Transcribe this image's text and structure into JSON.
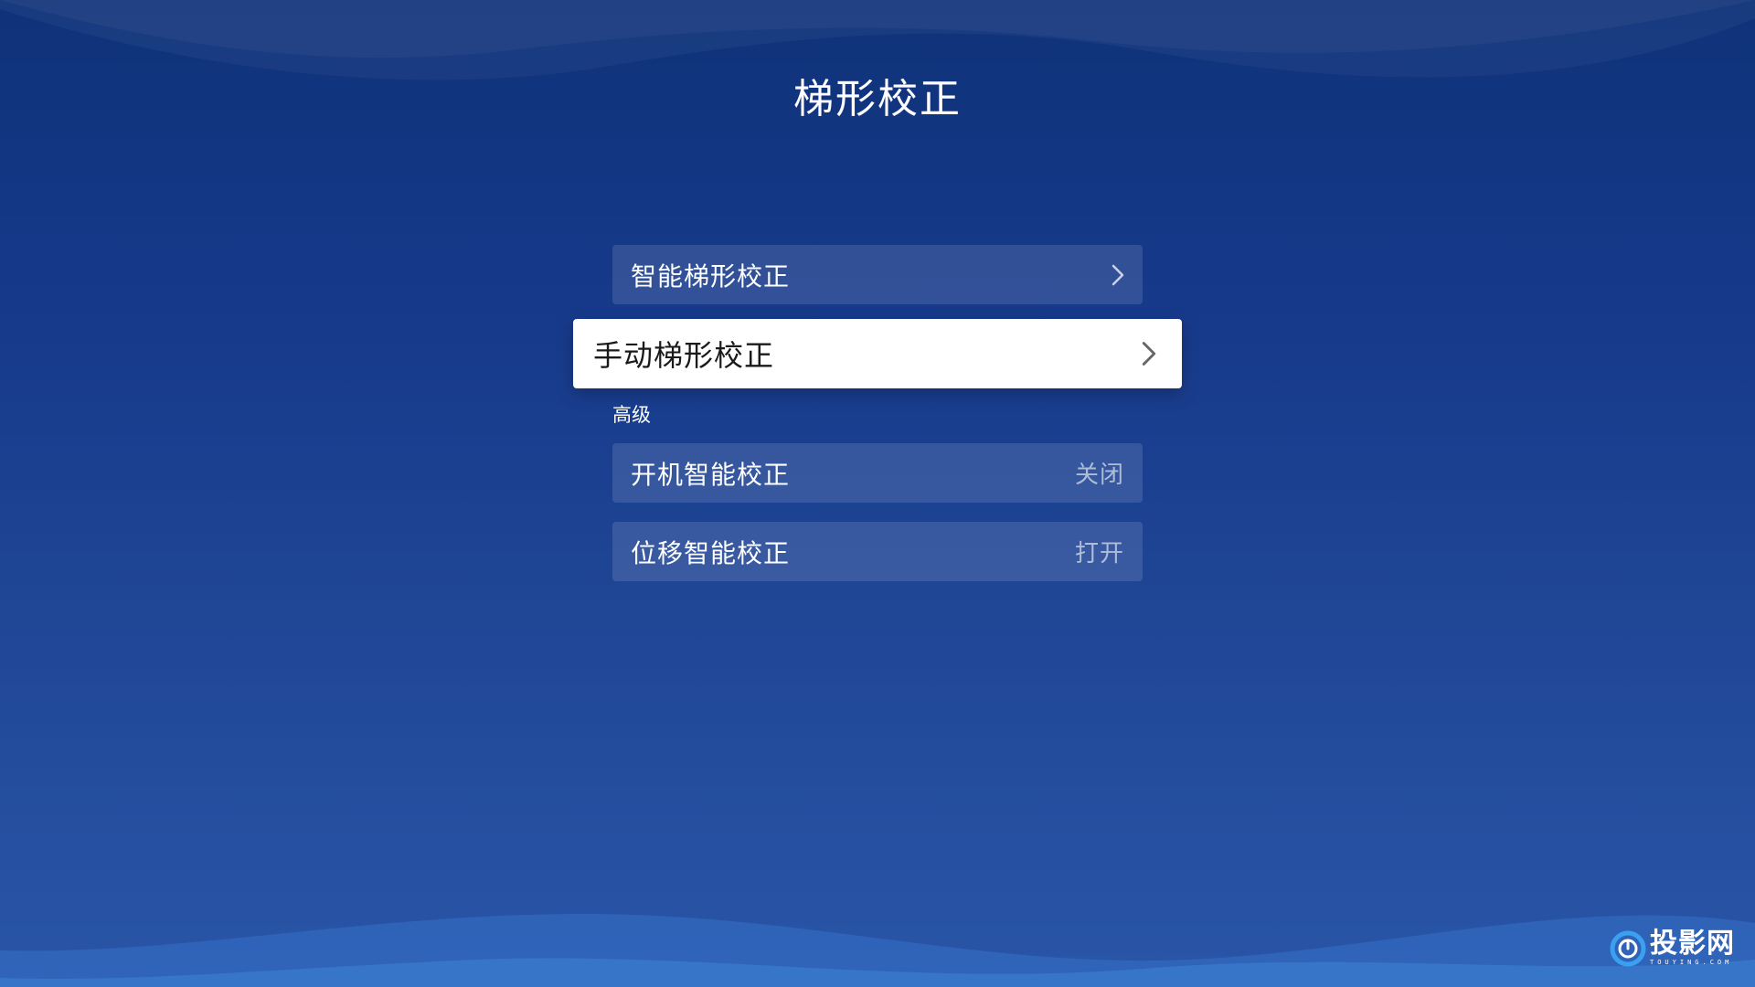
{
  "title": "梯形校正",
  "menu": [
    {
      "label": "智能梯形校正",
      "icon": "chevron-right-icon"
    },
    {
      "label": "手动梯形校正",
      "icon": "chevron-right-icon",
      "focused": true
    }
  ],
  "advanced": {
    "header": "高级",
    "items": [
      {
        "label": "开机智能校正",
        "value": "关闭"
      },
      {
        "label": "位移智能校正",
        "value": "打开"
      }
    ]
  },
  "watermark": {
    "name": "投影网",
    "domain": "TOUYING.COM",
    "icon": "touying-logo-icon"
  },
  "colors": {
    "background_top": "#0f3279",
    "background_bottom": "#2a56a8",
    "focused_item_bg": "#ffffff",
    "focused_text": "#1a1a1a",
    "value_text": "rgba(255,255,255,0.6)"
  }
}
